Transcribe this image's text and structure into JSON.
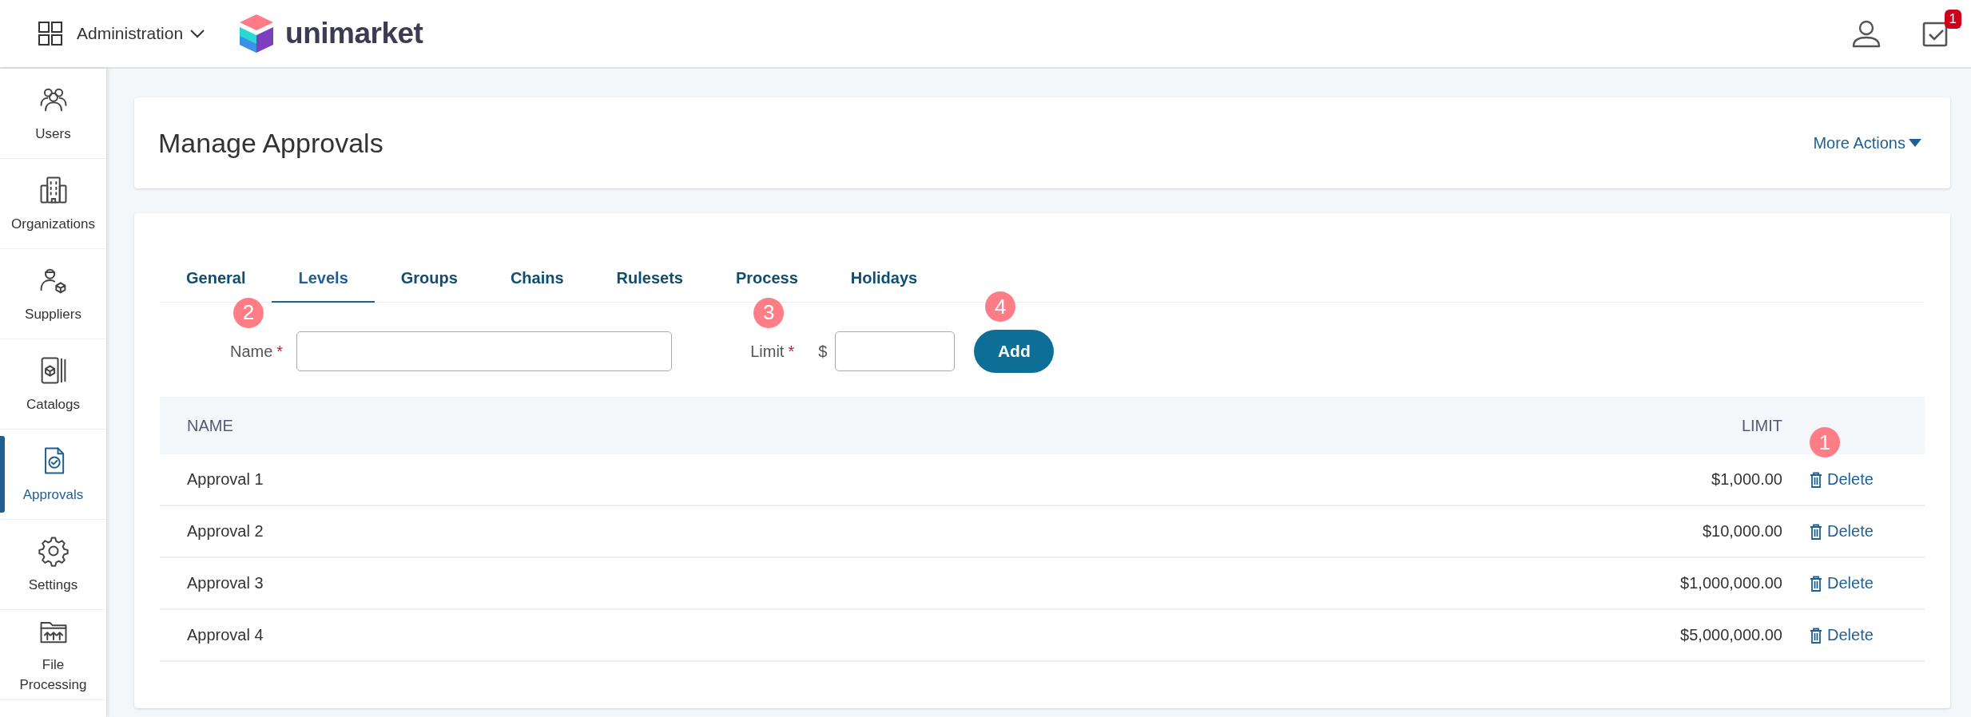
{
  "topbar": {
    "menu": "Administration",
    "logo": "unimarket",
    "notification_count": "1"
  },
  "sidebar": {
    "items": [
      {
        "label": "Users",
        "selected": false
      },
      {
        "label": "Organizations",
        "selected": false
      },
      {
        "label": "Suppliers",
        "selected": false
      },
      {
        "label": "Catalogs",
        "selected": false
      },
      {
        "label": "Approvals",
        "selected": true
      },
      {
        "label": "Settings",
        "selected": false
      },
      {
        "label": "File Processing",
        "selected": false
      }
    ]
  },
  "page": {
    "title": "Manage Approvals",
    "more_actions": "More Actions"
  },
  "tabs": [
    {
      "label": "General",
      "selected": false
    },
    {
      "label": "Levels",
      "selected": true
    },
    {
      "label": "Groups",
      "selected": false
    },
    {
      "label": "Chains",
      "selected": false
    },
    {
      "label": "Rulesets",
      "selected": false
    },
    {
      "label": "Process",
      "selected": false
    },
    {
      "label": "Holidays",
      "selected": false
    }
  ],
  "form": {
    "name_label": "Name",
    "name_required": "*",
    "name_marker": "2",
    "limit_label": "Limit",
    "limit_required": "*",
    "limit_marker": "3",
    "currency": "$",
    "add_button": "Add",
    "add_marker": "4"
  },
  "table": {
    "columns": [
      "NAME",
      "LIMIT"
    ],
    "action_marker": "1",
    "rows": [
      {
        "name": "Approval 1",
        "limit": "$1,000.00",
        "action": "Delete"
      },
      {
        "name": "Approval 2",
        "limit": "$10,000.00",
        "action": "Delete"
      },
      {
        "name": "Approval 3",
        "limit": "$1,000,000.00",
        "action": "Delete"
      },
      {
        "name": "Approval 4",
        "limit": "$5,000,000.00",
        "action": "Delete"
      }
    ]
  }
}
